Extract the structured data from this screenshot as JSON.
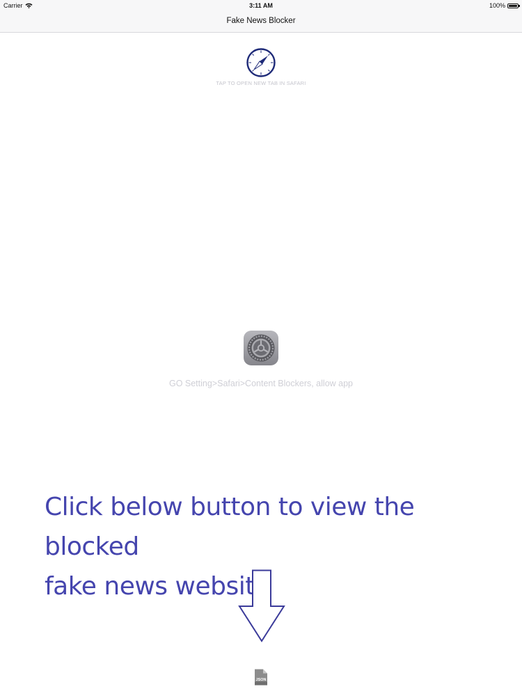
{
  "status_bar": {
    "carrier": "Carrier",
    "time": "3:11 AM",
    "battery": "100%"
  },
  "nav": {
    "title": "Fake News Blocker"
  },
  "safari": {
    "icon": "safari-compass-icon",
    "caption": "TAP TO OPEN NEW TAB IN SAFARI"
  },
  "settings": {
    "icon": "settings-gear-icon",
    "caption": "GO Setting>Safari>Content Blockers,  allow app"
  },
  "annotation": {
    "line1": "Click below button to view the blocked",
    "line2": "fake news website",
    "color": "#4545ae"
  },
  "json_button": {
    "icon": "json-file-icon",
    "label": "JSON"
  }
}
